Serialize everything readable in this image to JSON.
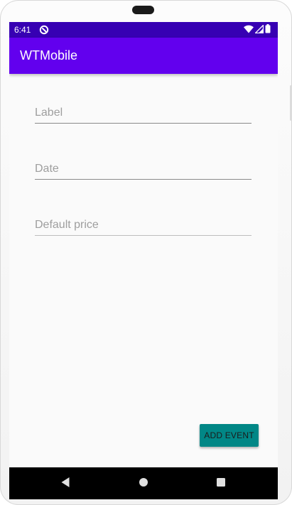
{
  "status_bar": {
    "time": "6:41",
    "app_icon": "app-notification-icon",
    "icons": [
      "wifi-icon",
      "signal-icon",
      "battery-icon"
    ],
    "color": "#3700b3"
  },
  "app_bar": {
    "title": "WTMobile",
    "color": "#6200ee"
  },
  "form": {
    "label_field": {
      "value": "",
      "placeholder": "Label"
    },
    "date_field": {
      "value": "",
      "placeholder": "Date"
    },
    "price_field": {
      "value": "",
      "placeholder": "Default price"
    }
  },
  "actions": {
    "add_event_label": "ADD EVENT",
    "button_color": "#018786"
  },
  "nav_bar": {
    "buttons": [
      "back-icon",
      "home-icon",
      "recents-icon"
    ]
  }
}
